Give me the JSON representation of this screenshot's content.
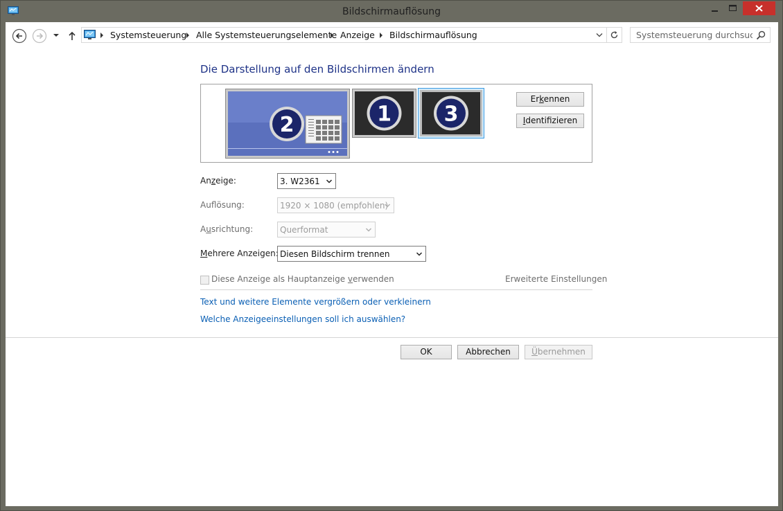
{
  "window": {
    "title": "Bildschirmauflösung",
    "controls": {
      "minimize": "–",
      "maximize": "□",
      "close": "✕"
    }
  },
  "navbar": {
    "back_icon": "back-arrow-icon",
    "forward_icon": "forward-arrow-icon",
    "up_icon": "up-arrow-icon",
    "breadcrumbs": [
      "Systemsteuerung",
      "Alle Systemsteuerungselemente",
      "Anzeige",
      "Bildschirmauflösung"
    ],
    "search_placeholder": "Systemsteuerung durchsuc…"
  },
  "main": {
    "heading": "Die Darstellung auf den Bildschirmen ändern",
    "monitors": [
      {
        "number": "2",
        "state": "inactive"
      },
      {
        "number": "1",
        "state": "active"
      },
      {
        "number": "3",
        "state": "selected"
      }
    ],
    "detect_button": "Er&kennen",
    "identify_button": "&Identifizieren",
    "fields": {
      "display": {
        "label": "An&zeige:",
        "value": "3. W2361"
      },
      "resolution": {
        "label": "Auf&lösung:",
        "value": "1920 × 1080 (empfohlen)"
      },
      "orientation": {
        "label": "A&usrichtung:",
        "value": "Querformat"
      },
      "multi_display": {
        "label": "&Mehrere Anzeigen:",
        "value": "Diesen Bildschirm trennen"
      }
    },
    "main_display_checkbox": "Diese Anzeige als Hauptanzeige &verwenden",
    "advanced_link": "Erweiterte Einstellungen",
    "links": [
      "Text und weitere Elemente vergrößern oder verkleinern",
      "Welche Anzeigeeinstellungen soll ich auswählen?"
    ]
  },
  "footer": {
    "ok_button": "OK",
    "cancel_button": "Abbrechen",
    "apply_button": "&Übernehmen"
  },
  "colors": {
    "window_frame": "#6b6b61",
    "close_button": "#c7302b",
    "heading": "#1e3287",
    "link": "#0a5fb4",
    "selected_monitor_border": "#3b9ae1",
    "inactive_monitor": "#5b70bd"
  }
}
